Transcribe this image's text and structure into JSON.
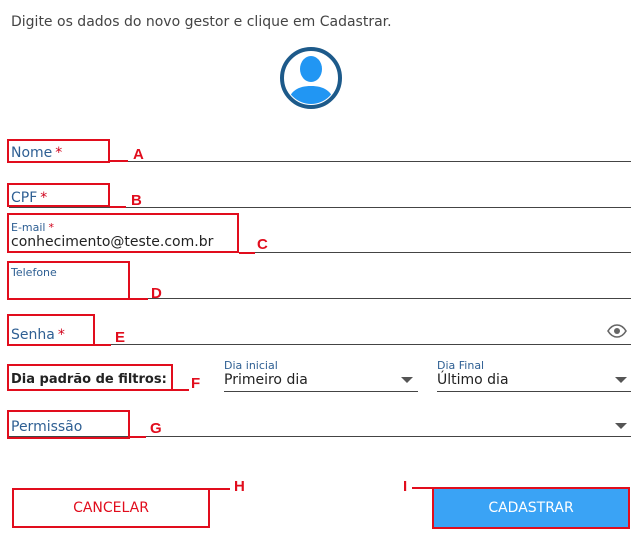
{
  "intro_text": "Digite os dados do novo gestor e clique em Cadastrar.",
  "fields": {
    "nome": {
      "label": "Nome",
      "required_mark": "*",
      "annotation": "A"
    },
    "cpf": {
      "label": "CPF",
      "required_mark": "*",
      "annotation": "B"
    },
    "email": {
      "label": "E-mail",
      "required_mark": "*",
      "value": "conhecimento@teste.com.br",
      "annotation": "C"
    },
    "telefone": {
      "label": "Telefone",
      "annotation": "D"
    },
    "senha": {
      "label": "Senha",
      "required_mark": "*",
      "annotation": "E"
    },
    "filtros": {
      "label": "Dia padrão de filtros:",
      "annotation": "F",
      "dia_inicial": {
        "label": "Dia inicial",
        "value": "Primeiro dia"
      },
      "dia_final": {
        "label": "Dia Final",
        "value": "Último dia"
      }
    },
    "permissao": {
      "label": "Permissão",
      "annotation": "G"
    }
  },
  "buttons": {
    "cancel": {
      "label": "CANCELAR",
      "annotation": "H"
    },
    "submit": {
      "label": "CADASTRAR",
      "annotation": "I"
    }
  },
  "colors": {
    "label_blue": "#2e5f93",
    "annotation_red": "#e10d1d",
    "submit_blue": "#3aa3f5",
    "avatar_blue": "#2196f3",
    "avatar_ring": "#1d5a8a"
  },
  "icons": {
    "avatar": "user-avatar-icon",
    "password_toggle": "eye-icon",
    "dropdown": "caret-down-icon"
  }
}
